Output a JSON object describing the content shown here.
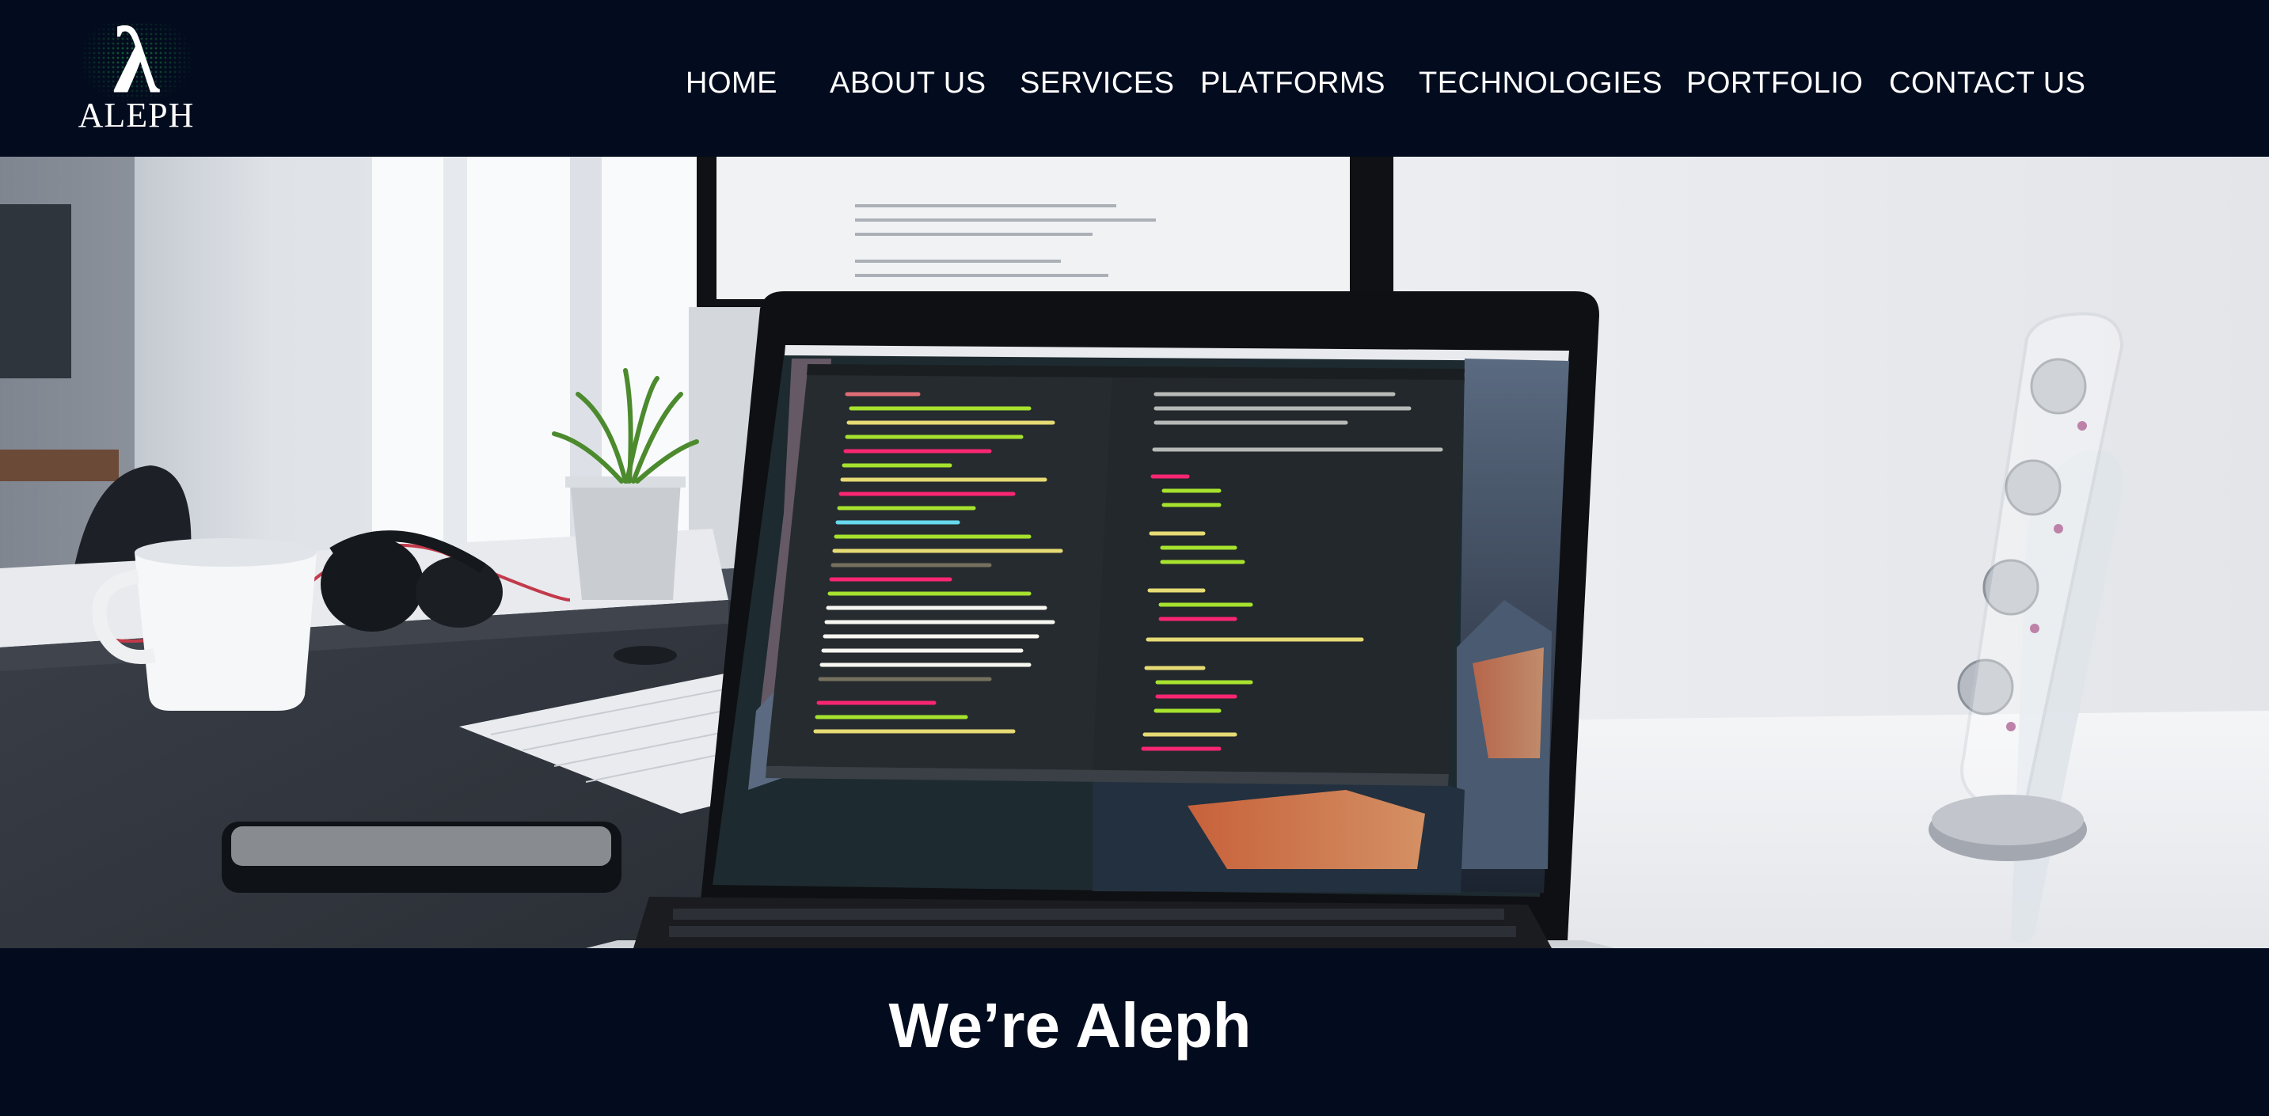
{
  "brand": {
    "logo_text": "ALEPH",
    "logo_symbol": "λ"
  },
  "nav": {
    "items": [
      {
        "label": "HOME"
      },
      {
        "label": "ABOUT US"
      },
      {
        "label": "SERVICES"
      },
      {
        "label": "PLATFORMS"
      },
      {
        "label": "TECHNOLOGIES"
      },
      {
        "label": "PORTFOLIO"
      },
      {
        "label": "CONTACT US"
      }
    ]
  },
  "hero": {
    "image_alt": "workspace-with-laptop-showing-code"
  },
  "intro": {
    "headline": "We’re Aleph"
  },
  "colors": {
    "header_bg": "#030c1e",
    "text": "#ffffff",
    "logo_accent": "#1f9a45"
  }
}
